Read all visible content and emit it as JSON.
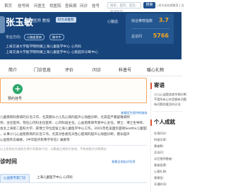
{
  "topnav": {
    "items": [
      "首页",
      "挂号网",
      "问医生",
      "找医院",
      "查疾病",
      "问诊",
      "挂号"
    ],
    "search_placeholder": "搜索，医院、医生、疾病医学",
    "search_button": "搜索",
    "right_text": "| 好大夫在线首页 | 注"
  },
  "doctor": {
    "name": "张玉敏",
    "title": "主任医师  教授",
    "tag": "好大夫推荐",
    "top_pick": "心脑血",
    "good_at_label": "专业方向：",
    "chips": [
      "心脑血管病",
      "脑卒中"
    ],
    "hospitals": [
      "上海交通大学医学院附属上海儿童医学中心 心内科",
      "上海交通大学医学院附属上海儿童医学中心 心脏超声诊断中心"
    ]
  },
  "stats": {
    "score_label": "综合推荐指数",
    "score_value": "3.7",
    "visits_label": "总访问",
    "visits_value": "5766"
  },
  "tabs": [
    "简介",
    "门诊信息",
    "评价",
    "问诊",
    "科普号",
    "暖心礼物"
  ],
  "appointment": {
    "label": "预约挂号",
    "link": "查看医生提供的服务"
  },
  "intro": {
    "lines": [
      "儿童疾病科疾病的诊治工作，尤其擅长小儿先心病的超声心动图诊断，尤其是严重疑难病例",
      "师，主任医师，现任心内科主任医师、心内科副主任，心血管疾病专家中心主任，博士、博士生导师，",
      "会主上海第二医科大学、获博士学位后留上海儿童医学中心工作。2001年赴美国华盛顿Seattle儿童医院",
      "，从事小儿心血管疾病的诊治工作。尤其对各类先天性心脏病的超声心动图诊断，擅长超声",
      "心血管杂志编委，《中华超声影像学杂志》编委等"
    ]
  },
  "note": "以上信息仅为该医生简介的基本介绍，以患者日常医疗咨询，不构成医疗诊断建议",
  "schedule": {
    "heading": "诊时间",
    "link": "查看全部出诊信息",
    "tabs": [
      "心血管专家门诊",
      "上海儿童医学中心 心内科"
    ]
  },
  "sidebar": {
    "letter_heading": "寄语",
    "letter_lines": [
      "小儿心血管疾病早期诊断",
      "不是所有心杂音都有问题",
      "有问题的要及时诊治"
    ],
    "achievement_heading": "个人成就",
    "achievement_rows": [
      "在线问诊：",
      "科普文章：",
      "患者数：",
      "总访问：",
      "诊后报到患者：",
      "患者投票：",
      "心意礼物：",
      "感谢信：",
      "开通时间："
    ]
  },
  "colors": {
    "brand": "#17447b",
    "accent": "#f5a623",
    "plus_green": "#2da86a",
    "card_border": "#f2a661"
  }
}
